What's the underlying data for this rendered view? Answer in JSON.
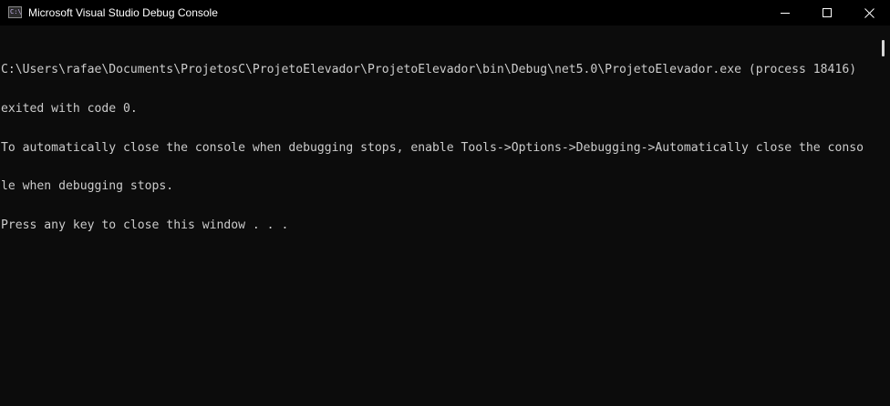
{
  "window": {
    "title": "Microsoft Visual Studio Debug Console",
    "icon": "console-app-icon",
    "icon_text": "C:\\",
    "controls": {
      "minimize_icon": "minimize-icon",
      "maximize_icon": "maximize-icon",
      "close_icon": "close-icon"
    }
  },
  "console": {
    "lines": [
      "C:\\Users\\rafae\\Documents\\ProjetosC\\ProjetoElevador\\ProjetoElevador\\bin\\Debug\\net5.0\\ProjetoElevador.exe (process 18416)",
      "exited with code 0.",
      "To automatically close the console when debugging stops, enable Tools->Options->Debugging->Automatically close the conso",
      "le when debugging stops.",
      "Press any key to close this window . . ."
    ]
  },
  "colors": {
    "background": "#0c0c0c",
    "titlebar": "#000000",
    "text": "#cccccc",
    "title_text": "#ffffff"
  }
}
